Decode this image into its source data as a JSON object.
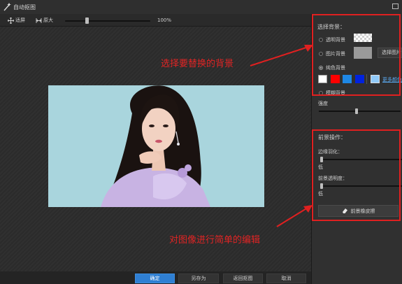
{
  "window": {
    "title": "自动抠图"
  },
  "toolbar": {
    "fit_label": "适屏",
    "original_label": "原大",
    "zoom_value": "100%"
  },
  "background_panel": {
    "heading": "选择背景：",
    "transparent_label": "透明背景",
    "image_label": "图片背景",
    "choose_image_label": "选择图片",
    "solid_label": "纯色背景",
    "selected_option": "纯色背景",
    "more_colors_label": "更多颜色",
    "blur_label": "模糊背景",
    "strength_label": "强度",
    "strength_value": 0.46,
    "colors": [
      "#ffffff",
      "#ff0000",
      "#1e88e5",
      "#0022dd",
      "#90caf9"
    ]
  },
  "foreground_panel": {
    "heading": "前景操作：",
    "feather_label": "边缘羽化：",
    "feather_value_label": "低",
    "feather_value": 0,
    "transparency_label": "前景透明度：",
    "transparency_value_label": "低",
    "transparency_value": 0,
    "eraser_label": "前景橡皮擦"
  },
  "bottom": {
    "confirm_label": "确定",
    "saveas_label": "另存为",
    "return_label": "返回抠图",
    "cancel_label": "取消"
  },
  "annotations": {
    "top": "选择要替换的背景",
    "bottom": "对图像进行简单的编辑"
  }
}
